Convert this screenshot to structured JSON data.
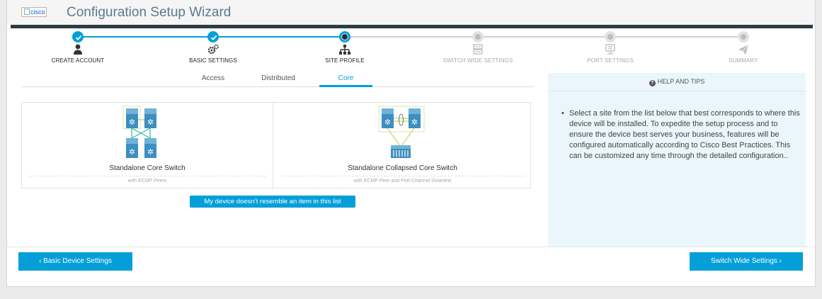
{
  "header": {
    "logo_alt": "cisco",
    "title": "Configuration Setup Wizard"
  },
  "stepper": {
    "steps": [
      {
        "label": "CREATE ACCOUNT",
        "state": "done",
        "icon": "user-icon"
      },
      {
        "label": "BASIC SETTINGS",
        "state": "done",
        "icon": "gears-icon"
      },
      {
        "label": "SITE PROFILE",
        "state": "current",
        "icon": "sitemap-icon"
      },
      {
        "label": "SWITCH WIDE SETTINGS",
        "state": "todo",
        "icon": "switch-stack-icon"
      },
      {
        "label": "PORT SETTINGS",
        "state": "todo",
        "icon": "port-icon"
      },
      {
        "label": "SUMMARY",
        "state": "todo",
        "icon": "send-icon"
      }
    ]
  },
  "tabs": [
    {
      "label": "Access",
      "active": false
    },
    {
      "label": "Distributed",
      "active": false
    },
    {
      "label": "Core",
      "active": true
    }
  ],
  "cards": [
    {
      "title": "Standalone Core Switch",
      "subtitle": "with ECMP Peers"
    },
    {
      "title": "Standalone Collapsed Core Switch",
      "subtitle": "with ECMP Peer and Port-Channel Downlink"
    }
  ],
  "no_match_button": "My device doesn’t resemble an item in this list",
  "help": {
    "title": "HELP AND TIPS",
    "text": "Select a site from the list below that best corresponds to where this device will be installed. To expedite the setup process and to ensure the device best serves your business, features will be configured automatically according to Cisco Best Practices. This can be customized any time through the detailed configuration.."
  },
  "footer": {
    "back_label": "‹ Basic Device Settings",
    "next_label": "Switch Wide Settings ›"
  },
  "colors": {
    "accent": "#049fd9",
    "dark_bar": "#2d3b44",
    "help_bg": "#eaf6fb"
  }
}
